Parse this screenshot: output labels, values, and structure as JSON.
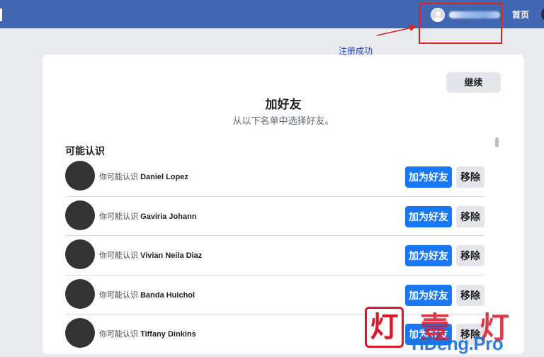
{
  "topbar": {
    "home_label": "首页",
    "accent": "#4267b2"
  },
  "annotation": {
    "label": "注册成功",
    "box_color": "#e0201f"
  },
  "card": {
    "continue_label": "继续",
    "title": "加好友",
    "subtitle": "从以下名单中选择好友。",
    "section_title": "可能认识",
    "suggestions": [
      {
        "prefix": "你可能认识",
        "name": "Daniel Lopez",
        "add_label": "加为好友",
        "remove_label": "移除"
      },
      {
        "prefix": "你可能认识",
        "name": "Gaviria Johann",
        "add_label": "加为好友",
        "remove_label": "移除"
      },
      {
        "prefix": "你可能认识",
        "name": "Vivian Neila Diaz",
        "add_label": "加为好友",
        "remove_label": "移除"
      },
      {
        "prefix": "你可能认识",
        "name": "Banda Huichol",
        "add_label": "加为好友",
        "remove_label": "移除"
      },
      {
        "prefix": "你可能认识",
        "name": "Tiffany Dinkins",
        "add_label": "加为好友",
        "remove_label": "移除"
      }
    ],
    "primary_color": "#1877f2"
  },
  "watermark": {
    "char_box": "灯",
    "char_2": "壹",
    "char_3": "灯",
    "domain": "YiDeng.Pro"
  }
}
